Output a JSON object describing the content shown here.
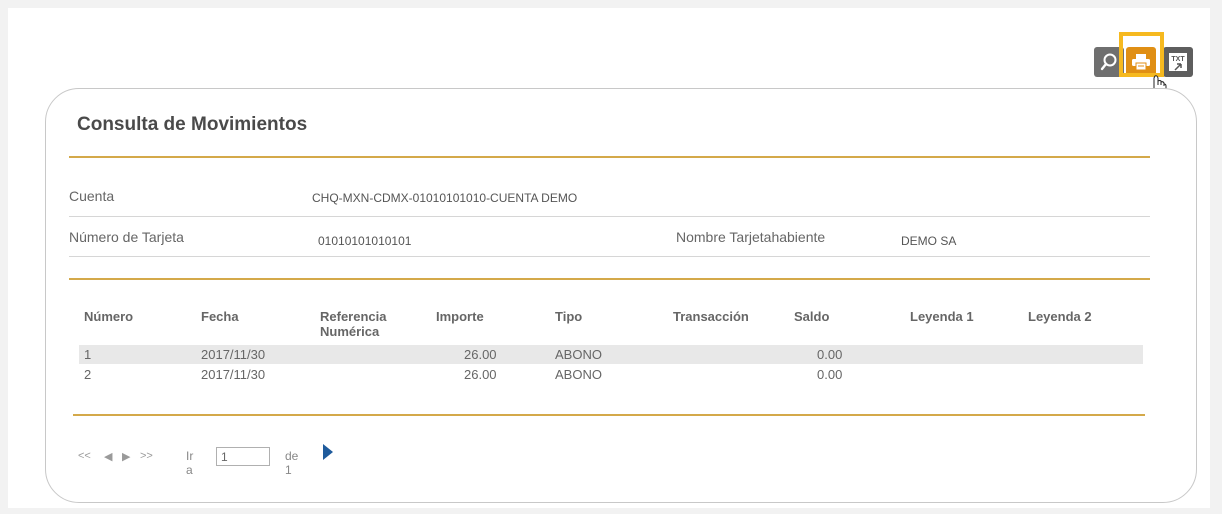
{
  "toolbar": {
    "search_icon": "search-icon",
    "print_icon": "printer-icon",
    "txt_icon": "txt-export-icon",
    "txt_label": "TXT",
    "highlight_color": "#f6b91f"
  },
  "card": {
    "title": "Consulta de Movimientos"
  },
  "fields": {
    "cuenta_label": "Cuenta",
    "cuenta_value": "CHQ-MXN-CDMX-01010101010-CUENTA DEMO",
    "tarjeta_label": "Número de Tarjeta",
    "tarjeta_value": "01010101010101",
    "titular_label": "Nombre Tarjetahabiente",
    "titular_value": "DEMO SA"
  },
  "table": {
    "headers": [
      "Número",
      "Fecha",
      "Referencia Numérica",
      "Importe",
      "Tipo",
      "Transacción",
      "Saldo",
      "Leyenda 1",
      "Leyenda 2"
    ],
    "rows": [
      {
        "numero": "1",
        "fecha": "2017/11/30",
        "referencia": "",
        "importe": "26.00",
        "tipo": "ABONO",
        "transaccion": "",
        "saldo": "0.00",
        "leyenda1": "",
        "leyenda2": ""
      },
      {
        "numero": "2",
        "fecha": "2017/11/30",
        "referencia": "",
        "importe": "26.00",
        "tipo": "ABONO",
        "transaccion": "",
        "saldo": "0.00",
        "leyenda1": "",
        "leyenda2": ""
      }
    ]
  },
  "pager": {
    "goto_label": "Ir a",
    "page_value": "1",
    "of_label": "de 1"
  },
  "colors": {
    "accent_gold": "#d4a94a",
    "print_button": "#e08f14",
    "next_arrow": "#1f5b9c"
  }
}
